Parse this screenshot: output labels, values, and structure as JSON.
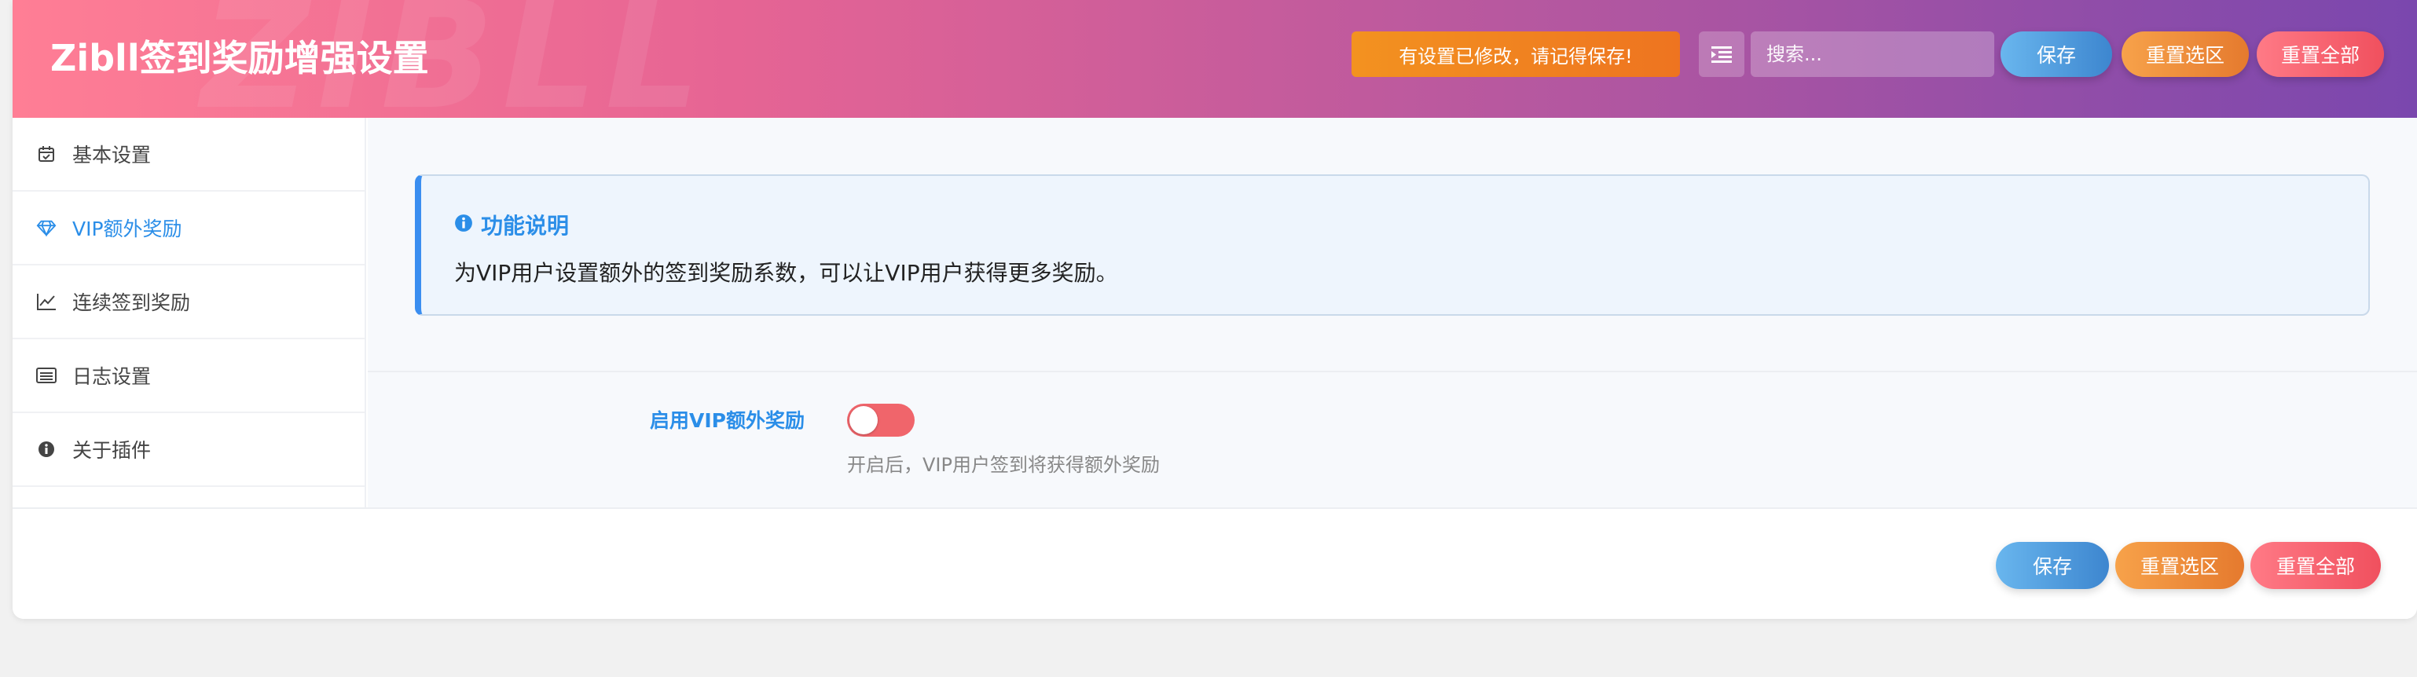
{
  "header": {
    "title": "Zibll签到奖励增强设置",
    "watermark": "ZIBLL",
    "notice": "有设置已修改，请记得保存!",
    "search_placeholder": "搜索...",
    "save_label": "保存",
    "reset_section_label": "重置选区",
    "reset_all_label": "重置全部"
  },
  "sidebar": {
    "items": [
      {
        "label": "基本设置",
        "icon": "calendar-check-icon",
        "active": false
      },
      {
        "label": "VIP额外奖励",
        "icon": "diamond-icon",
        "active": true
      },
      {
        "label": "连续签到奖励",
        "icon": "line-chart-icon",
        "active": false
      },
      {
        "label": "日志设置",
        "icon": "list-alt-icon",
        "active": false
      },
      {
        "label": "关于插件",
        "icon": "info-circle-icon",
        "active": false
      }
    ]
  },
  "main": {
    "info": {
      "title": "功能说明",
      "text": "为VIP用户设置额外的签到奖励系数，可以让VIP用户获得更多奖励。"
    },
    "field": {
      "label": "启用VIP额外奖励",
      "enabled": false,
      "help": "开启后，VIP用户签到将获得额外奖励"
    }
  },
  "footer": {
    "save_label": "保存",
    "reset_section_label": "重置选区",
    "reset_all_label": "重置全部"
  },
  "colors": {
    "accent": "#2b8ee8",
    "notice": "#f39220",
    "toggle_off": "#f0656b"
  }
}
